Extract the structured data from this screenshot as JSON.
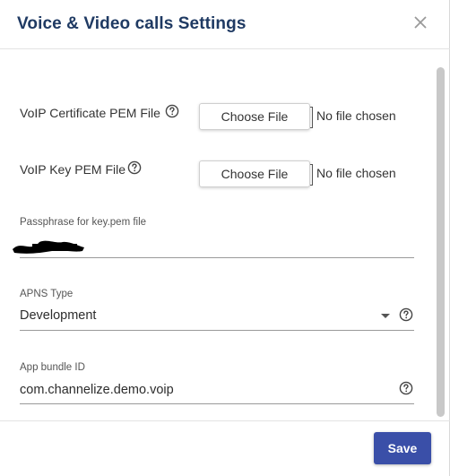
{
  "dialog": {
    "title": "Voice & Video calls Settings",
    "close_icon": "close-icon"
  },
  "form": {
    "voip_cert": {
      "label": "VoIP Certificate PEM File",
      "button_label": "Choose File",
      "status": "No file chosen",
      "help_icon": "question-circle-icon"
    },
    "voip_key": {
      "label": "VoIP Key PEM File",
      "button_label": "Choose File",
      "status": "No file chosen",
      "help_icon": "question-circle-icon"
    },
    "passphrase": {
      "label": "Passphrase for key.pem file",
      "value": "",
      "redacted": true
    },
    "apns_type": {
      "label": "APNS Type",
      "selected": "Development",
      "help_icon": "question-circle-icon"
    },
    "bundle_id": {
      "label": "App bundle ID",
      "value": "com.channelize.demo.voip",
      "help_icon": "question-circle-icon"
    }
  },
  "footer": {
    "save_label": "Save"
  },
  "colors": {
    "title": "#1f3a63",
    "primary_button": "#3a4fa8",
    "scrollbar": "#c8c8c8"
  }
}
